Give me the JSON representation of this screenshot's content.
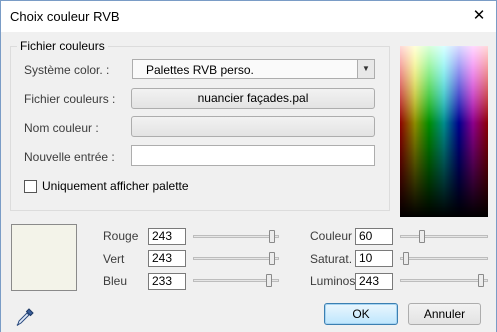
{
  "window": {
    "title": "Choix couleur RVB",
    "close_glyph": "✕"
  },
  "group": {
    "title": "Fichier couleurs",
    "system_label": "Système color. :",
    "system_value": "Palettes RVB perso.",
    "file_label": "Fichier couleurs :",
    "file_button": "nuancier façades.pal",
    "name_label": "Nom couleur :",
    "name_value": "",
    "new_entry_label": "Nouvelle entrée :",
    "new_entry_value": ""
  },
  "palette_only": {
    "label": "Uniquement afficher palette",
    "checked": false
  },
  "preview_color": "#f3f3e9",
  "rgb": {
    "red_label": "Rouge",
    "red_value": "243",
    "green_label": "Vert",
    "green_value": "243",
    "blue_label": "Bleu",
    "blue_value": "233",
    "max": 255
  },
  "hsl": {
    "hue_label": "Couleur",
    "hue_value": "60",
    "sat_label": "Saturat.",
    "sat_value": "10",
    "lum_label": "Luminos",
    "lum_value": "243",
    "max": 255
  },
  "buttons": {
    "ok": "OK",
    "cancel": "Annuler"
  },
  "icons": {
    "eyedropper": "eyedropper-icon",
    "dropdown": "chevron-down-icon"
  }
}
